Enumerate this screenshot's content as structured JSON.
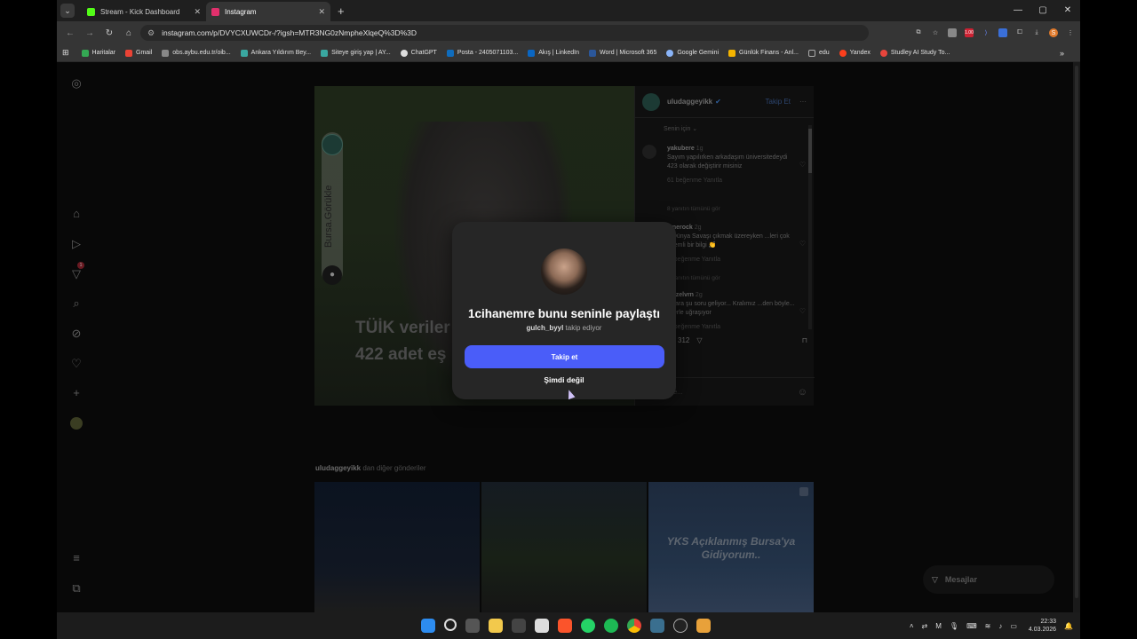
{
  "browser": {
    "tabs": [
      {
        "title": "Stream - Kick Dashboard",
        "favicon_color": "#53fc18",
        "active": false
      },
      {
        "title": "Instagram",
        "favicon_color": "#e1306c",
        "active": true
      }
    ],
    "url": "instagram.com/p/DVYCXUWCDr-/?igsh=MTR3NG0zNmpheXlqeQ%3D%3D",
    "bookmarks": [
      {
        "label": "Haritalar",
        "color": "#34a853"
      },
      {
        "label": "Gmail",
        "color": "#ea4335"
      },
      {
        "label": "obs.aybu.edu.tr/oib...",
        "color": "#888888"
      },
      {
        "label": "Ankara Yıldırım Bey...",
        "color": "#3aa7a0"
      },
      {
        "label": "Siteye giriş yap | AY...",
        "color": "#3aa7a0"
      },
      {
        "label": "ChatGPT",
        "color": "#dddddd"
      },
      {
        "label": "Posta - 2405071103...",
        "color": "#0f6cbd"
      },
      {
        "label": "Akış | LinkedIn",
        "color": "#0a66c2"
      },
      {
        "label": "Word | Microsoft 365",
        "color": "#2b579a"
      },
      {
        "label": "Google Gemini",
        "color": "#8ab4f8"
      },
      {
        "label": "Günlük Finans - Anl...",
        "color": "#f4b400"
      },
      {
        "label": "edu",
        "color": "#aaaaaa"
      },
      {
        "label": "Yandex",
        "color": "#fc3f1d"
      },
      {
        "label": "Studley AI Study To...",
        "color": "#e8453c"
      }
    ],
    "ext_badge": "1.00"
  },
  "nav": {
    "notification_count": "1"
  },
  "post": {
    "author": "uludaggeyikk",
    "follow_label": "Takip Et",
    "pill_text": "Bursa.Görükle",
    "overlay_line1": "TÜİK veriler",
    "overlay_line2": "422 adet eş",
    "for_you": "Senin için",
    "comments": [
      {
        "user": "yakubere",
        "time": "1g",
        "text": "Sayım yapılırken arkadaşım üniversitedeydi 423 olarak değiştirir misiniz",
        "meta": "61 beğenme   Yanıtla",
        "replies": "8 yanıtın tümünü gör"
      },
      {
        "user": "...nerock",
        "time": "2g",
        "text": "...Dünya Savaşı çıkmak üzereyken ...leri çok önemli bir bilgi 👏",
        "meta": "... beğenme   Yanıtla",
        "replies": "2 yanıtın tümünü gör"
      },
      {
        "user": "...ezelvrn",
        "time": "2g",
        "text": "...llara şu soru geliyor... Kralımız ...den böyle... İşlerle uğraşıyor",
        "meta": "... beğenme   Yanıtla",
        "replies": ""
      }
    ],
    "likes": "312",
    "add_comment": "...orum ekle..."
  },
  "more_from": {
    "user": "uludaggeyikk",
    "suffix": " dan diğer gönderiler",
    "tile3_text": "YKS Açıklanmış Bursa'ya Gidiyorum.."
  },
  "messages_label": "Mesajlar",
  "modal": {
    "title": "1cihanemre bunu seninle paylaştı",
    "sub_user": "gulch_byyl",
    "sub_text": " takip ediyor",
    "follow_btn": "Takip et",
    "not_now": "Şimdi değil"
  },
  "taskbar": {
    "time": "22:33",
    "date": "4.03.2026"
  }
}
